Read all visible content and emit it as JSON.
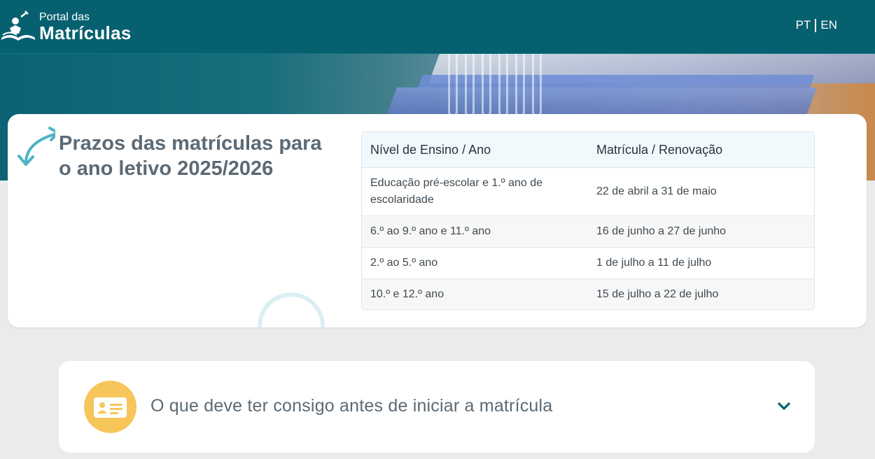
{
  "header": {
    "logo_small": "Portal das",
    "logo_big": "Matrículas",
    "lang_pt": "PT",
    "lang_en": "EN"
  },
  "deadlines": {
    "title_line1": "Prazos das matrículas para",
    "title_line2": "o ano letivo 2025/2026",
    "columns": [
      "Nível de Ensino / Ano",
      "Matrícula / Renovação"
    ],
    "rows": [
      {
        "level": "Educação pré-escolar e 1.º ano de escolaridade",
        "period": "22 de abril a 31 de maio"
      },
      {
        "level": "6.º ao 9.º ano e 11.º ano",
        "period": "16 de junho a 27 de junho"
      },
      {
        "level": "2.º ao 5.º ano",
        "period": "1 de julho a 11 de julho"
      },
      {
        "level": "10.º e 12.º ano",
        "period": "15 de julho a 22 de julho"
      }
    ]
  },
  "accordion": {
    "label": "O que deve ter consigo antes de iniciar a matrícula"
  },
  "colors": {
    "header_bg": "#07606f",
    "accent_teal": "#4db3c3",
    "icon_yellow": "#f6c65b",
    "chevron": "#07606f"
  },
  "icons": [
    "logo-icon",
    "double-arrow-icon",
    "id-card-icon",
    "chevron-down-icon"
  ]
}
